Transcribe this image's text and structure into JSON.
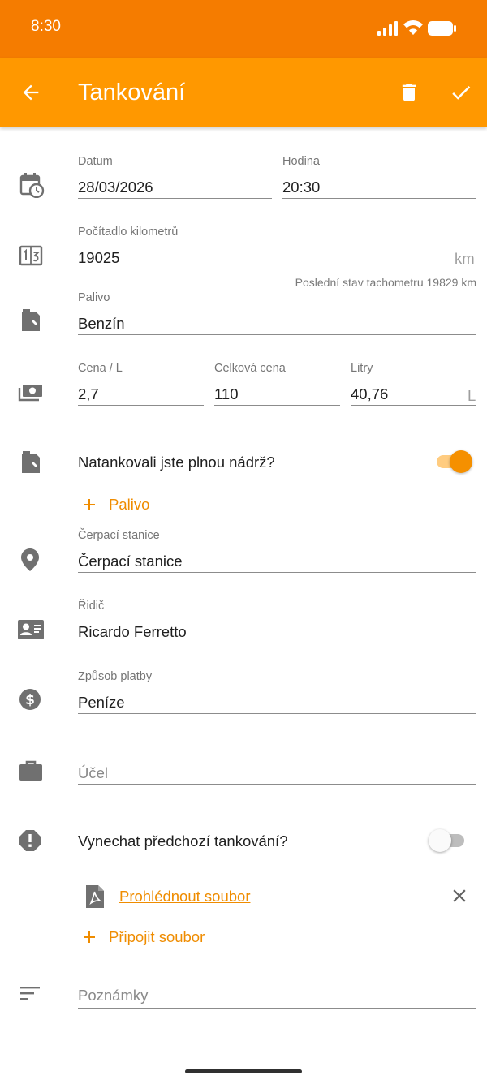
{
  "status_bar": {
    "time": "8:30"
  },
  "app_bar": {
    "title": "Tankování"
  },
  "form": {
    "date": {
      "label": "Datum",
      "value": "28/03/2026"
    },
    "time": {
      "label": "Hodina",
      "value": "20:30"
    },
    "odometer": {
      "label": "Počítadlo kilometrů",
      "value": "19025",
      "unit": "km",
      "helper": "Poslední stav tachometru 19829 km"
    },
    "fuel": {
      "label": "Palivo",
      "value": "Benzín"
    },
    "price_per_liter": {
      "label": "Cena / L",
      "value": "2,7"
    },
    "total_price": {
      "label": "Celková cena",
      "value": "110"
    },
    "liters": {
      "label": "Litry",
      "value": "40,76",
      "unit": "L"
    },
    "full_tank": {
      "label": "Natankovali jste plnou nádrž?",
      "checked": true
    },
    "add_fuel": {
      "label": "Palivo"
    },
    "station": {
      "label": "Čerpací stanice",
      "value": "Čerpací stanice"
    },
    "driver": {
      "label": "Řidič",
      "value": "Ricardo Ferretto"
    },
    "payment": {
      "label": "Způsob platby",
      "value": "Peníze"
    },
    "purpose": {
      "placeholder": "Účel"
    },
    "skip_previous": {
      "label": "Vynechat předchozí tankování?",
      "checked": false
    },
    "attachment": {
      "label": "Prohlédnout soubor"
    },
    "attach_file": {
      "label": "Připojit soubor"
    },
    "notes": {
      "placeholder": "Poznámky"
    }
  },
  "colors": {
    "status_bar": "#f57c00",
    "app_bar": "#ff9800",
    "accent": "#ef8c00"
  }
}
